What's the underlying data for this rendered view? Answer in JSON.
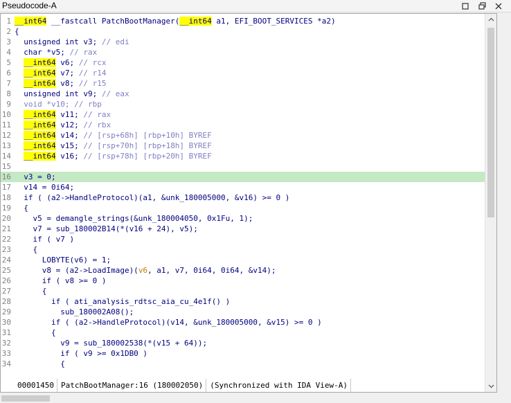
{
  "window": {
    "title": "Pseudocode-A",
    "status": {
      "offset": "00001450",
      "location": "PatchBootManager:16 (180002050)",
      "sync": "(Synchronized with IDA View-A)"
    }
  },
  "editor": {
    "highlighted_line": 16,
    "lines": [
      {
        "n": "1",
        "tokens": [
          {
            "t": "__int64",
            "c": "y"
          },
          {
            "t": " __fastcall PatchBootManager(",
            "c": "f"
          },
          {
            "t": "__int64",
            "c": "y"
          },
          {
            "t": " a1, EFI_BOOT_SERVICES *a2)",
            "c": "f"
          }
        ]
      },
      {
        "n": "2",
        "tokens": [
          {
            "t": "{",
            "c": "p"
          }
        ]
      },
      {
        "n": "3",
        "tokens": [
          {
            "t": "  unsigned int v3; ",
            "c": "d"
          },
          {
            "t": "// edi",
            "c": "c"
          }
        ]
      },
      {
        "n": "4",
        "tokens": [
          {
            "t": "  char *v5; ",
            "c": "d"
          },
          {
            "t": "// rax",
            "c": "c"
          }
        ]
      },
      {
        "n": "5",
        "tokens": [
          {
            "t": "  ",
            "c": "d"
          },
          {
            "t": "__int64",
            "c": "y"
          },
          {
            "t": " v6; ",
            "c": "d"
          },
          {
            "t": "// rcx",
            "c": "c"
          }
        ]
      },
      {
        "n": "6",
        "tokens": [
          {
            "t": "  ",
            "c": "d"
          },
          {
            "t": "__int64",
            "c": "y"
          },
          {
            "t": " v7; ",
            "c": "d"
          },
          {
            "t": "// r14",
            "c": "c"
          }
        ]
      },
      {
        "n": "7",
        "tokens": [
          {
            "t": "  ",
            "c": "d"
          },
          {
            "t": "__int64",
            "c": "y"
          },
          {
            "t": " v8; ",
            "c": "d"
          },
          {
            "t": "// r15",
            "c": "c"
          }
        ]
      },
      {
        "n": "8",
        "tokens": [
          {
            "t": "  unsigned int v9; ",
            "c": "d"
          },
          {
            "t": "// eax",
            "c": "c"
          }
        ]
      },
      {
        "n": "9",
        "tokens": [
          {
            "t": "  void *v10; ",
            "c": "c"
          },
          {
            "t": "// rbp",
            "c": "c"
          }
        ]
      },
      {
        "n": "10",
        "tokens": [
          {
            "t": "  ",
            "c": "d"
          },
          {
            "t": "__int64",
            "c": "y"
          },
          {
            "t": " v11; ",
            "c": "d"
          },
          {
            "t": "// rax",
            "c": "c"
          }
        ]
      },
      {
        "n": "11",
        "tokens": [
          {
            "t": "  ",
            "c": "d"
          },
          {
            "t": "__int64",
            "c": "y"
          },
          {
            "t": " v12; ",
            "c": "d"
          },
          {
            "t": "// rbx",
            "c": "c"
          }
        ]
      },
      {
        "n": "12",
        "tokens": [
          {
            "t": "  ",
            "c": "d"
          },
          {
            "t": "__int64",
            "c": "y"
          },
          {
            "t": " v14; ",
            "c": "d"
          },
          {
            "t": "// [rsp+68h] [rbp+10h] BYREF",
            "c": "c"
          }
        ]
      },
      {
        "n": "13",
        "tokens": [
          {
            "t": "  ",
            "c": "d"
          },
          {
            "t": "__int64",
            "c": "y"
          },
          {
            "t": " v15; ",
            "c": "d"
          },
          {
            "t": "// [rsp+70h] [rbp+18h] BYREF",
            "c": "c"
          }
        ]
      },
      {
        "n": "14",
        "tokens": [
          {
            "t": "  ",
            "c": "d"
          },
          {
            "t": "__int64",
            "c": "y"
          },
          {
            "t": " v16; ",
            "c": "d"
          },
          {
            "t": "// [rsp+78h] [rbp+20h] BYREF",
            "c": "c"
          }
        ]
      },
      {
        "n": "15",
        "tokens": []
      },
      {
        "n": "16",
        "tokens": [
          {
            "t": "  v3 = 0;",
            "c": "v"
          }
        ]
      },
      {
        "n": "17",
        "tokens": [
          {
            "t": "  v14 = 0i64;",
            "c": "v"
          }
        ]
      },
      {
        "n": "18",
        "tokens": [
          {
            "t": "  if ( (a2->HandleProtocol)(a1, &unk_180005000, &v16) >= 0 )",
            "c": "v"
          }
        ]
      },
      {
        "n": "19",
        "tokens": [
          {
            "t": "  {",
            "c": "p"
          }
        ]
      },
      {
        "n": "20",
        "tokens": [
          {
            "t": "    v5 = demangle_strings(&unk_180004050, 0x1Fu, 1);",
            "c": "v"
          }
        ]
      },
      {
        "n": "21",
        "tokens": [
          {
            "t": "    v7 = sub_180002B14(*(v16 + 24), v5);",
            "c": "v"
          }
        ]
      },
      {
        "n": "22",
        "tokens": [
          {
            "t": "    if ( v7 )",
            "c": "v"
          }
        ]
      },
      {
        "n": "23",
        "tokens": [
          {
            "t": "    {",
            "c": "p"
          }
        ]
      },
      {
        "n": "24",
        "tokens": [
          {
            "t": "      LOBYTE(v6) = 1;",
            "c": "v"
          }
        ]
      },
      {
        "n": "25",
        "tokens": [
          {
            "t": "      v8 = (a2->LoadImage)(",
            "c": "v"
          },
          {
            "t": "v6",
            "c": "o"
          },
          {
            "t": ", a1, v7, 0i64, 0i64, &v14);",
            "c": "v"
          }
        ]
      },
      {
        "n": "26",
        "tokens": [
          {
            "t": "      if ( v8 >= 0 )",
            "c": "v"
          }
        ]
      },
      {
        "n": "27",
        "tokens": [
          {
            "t": "      {",
            "c": "p"
          }
        ]
      },
      {
        "n": "28",
        "tokens": [
          {
            "t": "        if ( ati_analysis_rdtsc_aia_cu_4e1f() )",
            "c": "v"
          }
        ]
      },
      {
        "n": "29",
        "tokens": [
          {
            "t": "          sub_180002A08();",
            "c": "v"
          }
        ]
      },
      {
        "n": "30",
        "tokens": [
          {
            "t": "        if ( (a2->HandleProtocol)(v14, &unk_180005000, &v15) >= 0 )",
            "c": "v"
          }
        ]
      },
      {
        "n": "31",
        "tokens": [
          {
            "t": "        {",
            "c": "p"
          }
        ]
      },
      {
        "n": "32",
        "tokens": [
          {
            "t": "          v9 = sub_180002538(*(v15 + 64));",
            "c": "v"
          }
        ]
      },
      {
        "n": "33",
        "tokens": [
          {
            "t": "          if ( v9 >= 0x1DB0 )",
            "c": "v"
          }
        ]
      },
      {
        "n": "34",
        "tokens": [
          {
            "t": "          {",
            "c": "p"
          }
        ]
      }
    ]
  }
}
